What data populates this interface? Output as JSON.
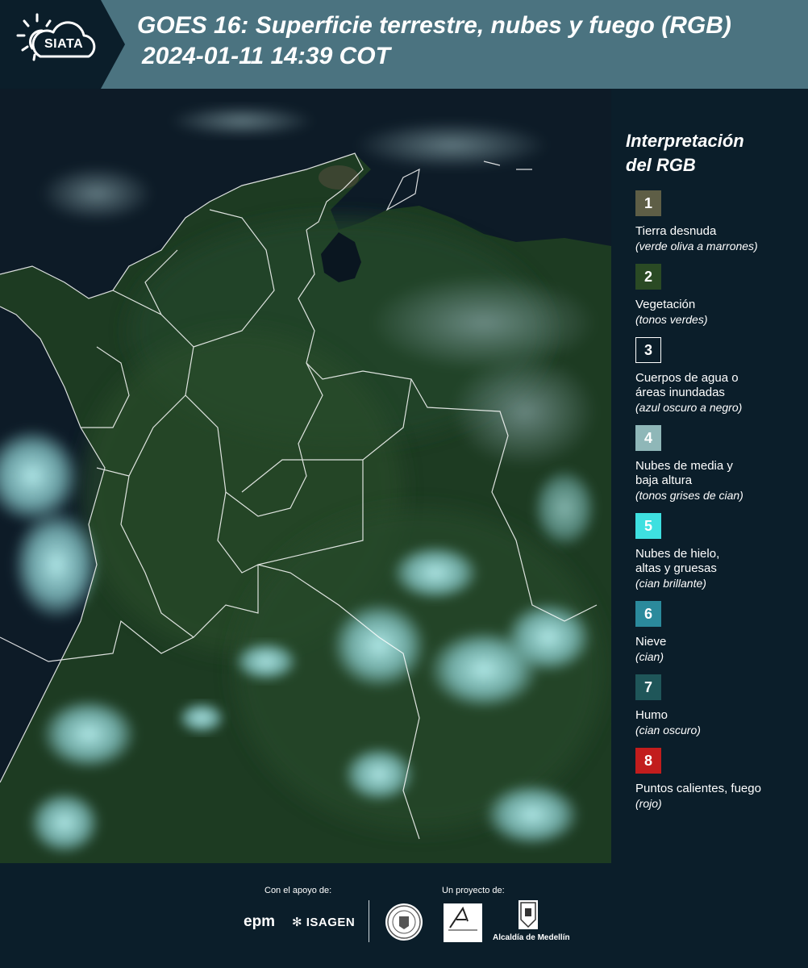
{
  "header": {
    "logo_text": "SIATA",
    "title": "GOES 16: Superficie terrestre, nubes y fuego (RGB)",
    "subtitle": "2024-01-11 14:39 COT",
    "colors": {
      "header_bg": "#4b7380",
      "logo_bg": "#0b1e2a"
    }
  },
  "legend": {
    "title_line1": "Interpretación",
    "title_line2": "del RGB",
    "items": [
      {
        "number": "1",
        "label": "Tierra desnuda",
        "desc": "(verde oliva a marrones)",
        "color": "#5e5e46"
      },
      {
        "number": "2",
        "label": "Vegetación",
        "desc": "(tonos verdes)",
        "color": "#2a4a24"
      },
      {
        "number": "3",
        "label_line1": "Cuerpos de agua o",
        "label_line2": "áreas inundadas",
        "desc": "(azul oscuro a negro)",
        "color": "#0b1e2a"
      },
      {
        "number": "4",
        "label_line1": "Nubes de media y",
        "label_line2": "baja altura",
        "desc": "(tonos grises de cian)",
        "color": "#8fb7b8"
      },
      {
        "number": "5",
        "label_line1": "Nubes de hielo,",
        "label_line2": "altas y gruesas",
        "desc": "(cian brillante)",
        "color": "#3ee0e0"
      },
      {
        "number": "6",
        "label": "Nieve",
        "desc": "(cian)",
        "color": "#2b8a9c"
      },
      {
        "number": "7",
        "label": "Humo",
        "desc": "(cian oscuro)",
        "color": "#1f5659"
      },
      {
        "number": "8",
        "label": "Puntos calientes, fuego",
        "desc": "(rojo)",
        "color": "#c21d1d"
      }
    ]
  },
  "footer": {
    "support_label": "Con el apoyo de:",
    "project_label": "Un proyecto de:",
    "epm": "epm",
    "isagen": "ISAGEN",
    "alcaldia": "Alcaldía de Medellín"
  }
}
